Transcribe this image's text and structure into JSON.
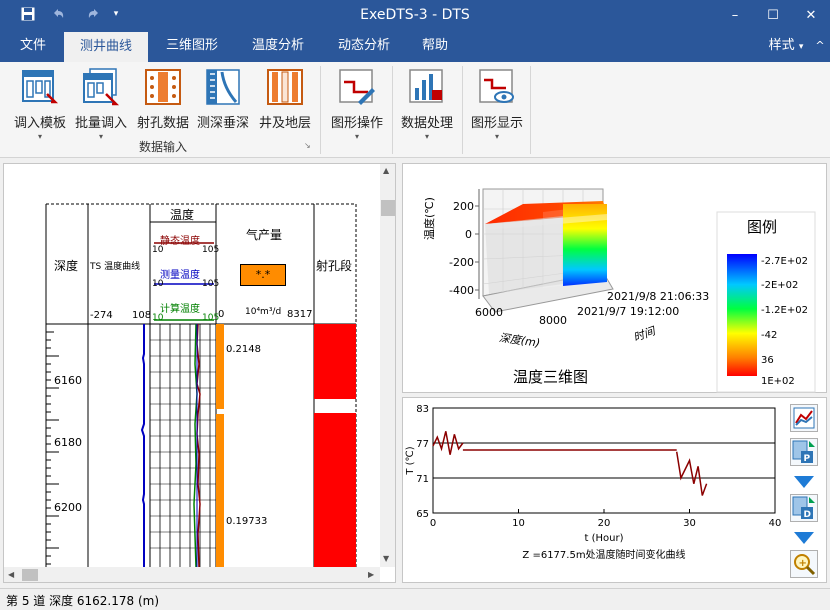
{
  "window": {
    "title": "ExeDTS-3 - DTS",
    "minimize": "–",
    "maximize": "☐",
    "close": "✕"
  },
  "quick_access": {
    "save_icon": "save-icon",
    "undo_icon": "undo-icon",
    "redo_icon": "redo-icon",
    "customize_icon": "dropdown-icon"
  },
  "menu": {
    "items": [
      "文件",
      "测井曲线",
      "三维图形",
      "温度分析",
      "动态分析",
      "帮助"
    ],
    "active_index": 1,
    "style_label": "样式",
    "style_caret": "▾",
    "collapse_icon": "^"
  },
  "ribbon": {
    "buttons": [
      {
        "label": "调入模板",
        "icon": "template-icon"
      },
      {
        "label": "批量调入",
        "icon": "batch-import-icon"
      },
      {
        "label": "射孔数据",
        "icon": "perforation-data-icon"
      },
      {
        "label": "测深垂深",
        "icon": "depth-conversion-icon"
      },
      {
        "label": "井及地层",
        "icon": "well-stratum-icon"
      },
      {
        "label": "图形操作",
        "icon": "graph-operation-icon"
      },
      {
        "label": "数据处理",
        "icon": "data-processing-icon"
      },
      {
        "label": "图形显示",
        "icon": "graph-display-icon"
      }
    ],
    "group_caption": "数据输入",
    "caret": "▾",
    "launcher": "↘"
  },
  "log_panel": {
    "headers": {
      "depth": "深度",
      "ts_curve": "TS 温度曲线",
      "temperature": "温度",
      "gas": "气产量",
      "perforation": "射孔段"
    },
    "ts_scale": {
      "min": "-274",
      "max": "108"
    },
    "temp_legends": [
      {
        "name": "静态温度",
        "min": "10",
        "max": "105",
        "color": "#8b0000"
      },
      {
        "name": "测量温度",
        "min": "10",
        "max": "105",
        "color": "#0000c0"
      },
      {
        "name": "计算温度",
        "min": "10",
        "max": "105",
        "color": "#008000"
      }
    ],
    "gas_badge": "*.*",
    "gas_scale": {
      "min": "0",
      "unit": "10⁴m³/d",
      "max": "8317"
    },
    "depth_labels": [
      "6160",
      "6180",
      "6200"
    ],
    "gas_values": [
      "0.2148",
      "0.19733"
    ],
    "scroll_up": "▲",
    "scroll_down": "▼",
    "scroll_left": "◀",
    "scroll_right": "▶"
  },
  "chart3d": {
    "title": "温度三维图",
    "zlabel": "温度(℃)",
    "xlabel": "深度(m)",
    "ylabel": "时间",
    "ztick_labels": [
      "200",
      "0",
      "-200",
      "-400"
    ],
    "xtick_labels": [
      "6000",
      "8000"
    ],
    "time_labels": [
      "2021/9/8 21:06:33",
      "2021/9/7 19:12:00"
    ],
    "legend_title": "图例",
    "legend_values": [
      "-2.7E+02",
      "-2E+02",
      "-1.2E+02",
      "-42",
      "36",
      "1E+02"
    ]
  },
  "chart_data": {
    "type": "line",
    "title": "Z =6177.5m处温度随时间变化曲线",
    "xlabel": "t (Hour)",
    "ylabel": "T (℃)",
    "xlim": [
      0,
      40
    ],
    "ylim": [
      65,
      83
    ],
    "xticks": [
      0,
      10,
      20,
      30,
      40
    ],
    "yticks": [
      65,
      71,
      77,
      83
    ],
    "hlines": [
      77,
      71
    ],
    "grid": false,
    "series": [
      {
        "color": "#8b0000",
        "segments": [
          {
            "x": [
              0,
              0.5,
              1,
              1.5,
              2,
              2.5,
              3,
              3.5
            ],
            "y": [
              76.5,
              78,
              76,
              79,
              75,
              78.5,
              76,
              77
            ]
          },
          {
            "x": [
              3.5,
              28.5
            ],
            "y": [
              75.8,
              75.8
            ]
          },
          {
            "x": [
              28.5,
              29,
              30,
              30.5,
              31,
              31.5,
              32
            ],
            "y": [
              75.5,
              71,
              74,
              70,
              73,
              68,
              70
            ]
          }
        ]
      }
    ]
  },
  "side_toolbar": {
    "buttons": [
      "chart-icon",
      "export-p-icon",
      "arrow-down-icon",
      "export-d-icon",
      "arrow-down-icon",
      "zoom-icon"
    ]
  },
  "status": {
    "text": "第 5 道 深度 6162.178 (m)"
  }
}
